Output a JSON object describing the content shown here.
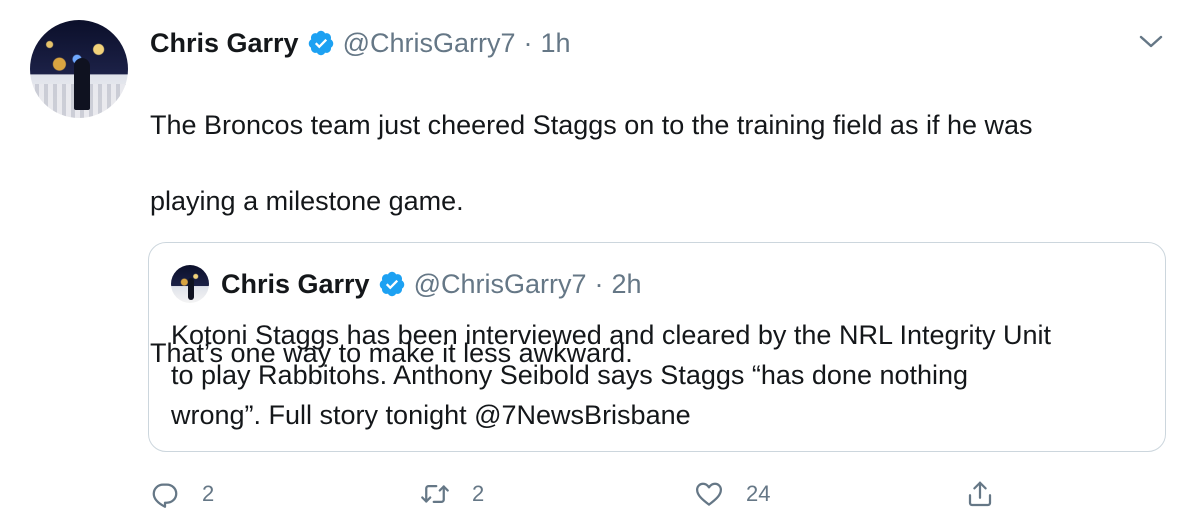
{
  "tweet": {
    "author_name": "Chris Garry",
    "handle": "@ChrisGarry7",
    "separator": "·",
    "time": "1h",
    "text_line1": "The Broncos team just cheered Staggs on to the training field as if he was",
    "text_line2": "playing a milestone game.",
    "text_line3": "That’s one way to make it less awkward."
  },
  "quoted": {
    "author_name": "Chris Garry",
    "handle": "@ChrisGarry7",
    "separator": "·",
    "time": "2h",
    "text_line1": "Kotoni Staggs has been interviewed and cleared by the NRL Integrity Unit",
    "text_line2": "to play Rabbitohs. Anthony Seibold says Staggs “has done nothing",
    "text_line3": "wrong”. Full story tonight @7NewsBrisbane"
  },
  "actions": {
    "reply_count": "2",
    "retweet_count": "2",
    "like_count": "24"
  },
  "icons": {
    "verified": "verified-badge-icon",
    "more": "chevron-down-icon",
    "reply": "reply-icon",
    "retweet": "retweet-icon",
    "like": "heart-icon",
    "share": "share-icon"
  },
  "colors": {
    "accent": "#1da1f2",
    "secondary_text": "#657786",
    "border": "#ccd6dd"
  }
}
